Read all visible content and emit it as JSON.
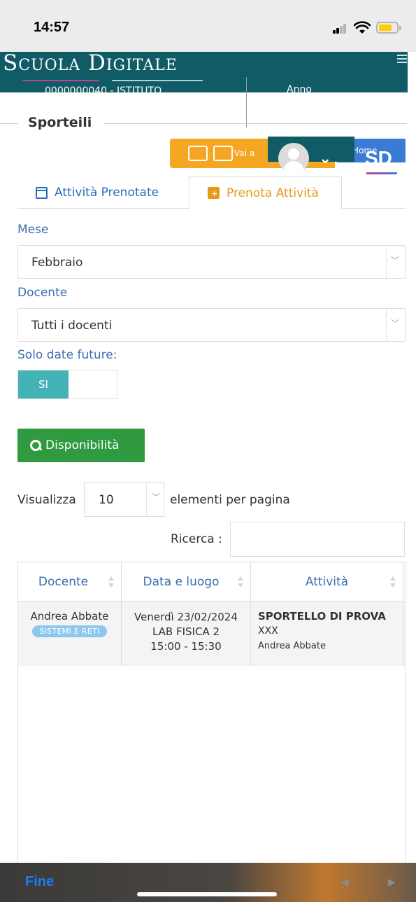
{
  "status_bar": {
    "time": "14:57"
  },
  "header": {
    "brand": "Scuola Digitale",
    "subtitle_left": "0000000040 - ISTITUTO",
    "subtitle_right": "Anno"
  },
  "page": {
    "section_title": "Sporteili"
  },
  "toolbar": {
    "vai_label": "Vai a",
    "home_label": "Home",
    "logo_text": "SD"
  },
  "tabs": [
    {
      "label": "Attività Prenotate",
      "active": false
    },
    {
      "label": "Prenota Attività",
      "active": true
    }
  ],
  "form": {
    "month_label": "Mese",
    "month_value": "Febbraio",
    "teacher_label": "Docente",
    "teacher_value": "Tutti i docenti",
    "future_label": "Solo date future:",
    "future_on_label": "SI",
    "availability_button": "Disponibilità"
  },
  "list_controls": {
    "show_label": "Visualizza",
    "page_length": "10",
    "per_page_label": "elementi per pagina",
    "search_label": "Ricerca :",
    "search_value": ""
  },
  "table": {
    "columns": [
      "Docente",
      "Data e luogo",
      "Attività"
    ],
    "rows": [
      {
        "teacher": "Andrea Abbate",
        "subject_badge": "SISTEMI E RETI",
        "date": "Venerdì 23/02/2024",
        "place": "LAB FISICA 2",
        "time": "15:00 - 15:30",
        "activity_title": "SPORTELLO DI PROVA",
        "activity_code": "XXX",
        "activity_teacher": "Andrea Abbate"
      }
    ]
  },
  "bottom_bar": {
    "done_label": "Fine"
  },
  "colors": {
    "header_teal": "#0f5c66",
    "accent_orange": "#e69a1a",
    "link_blue": "#3a6fb0",
    "button_green": "#2f9a3f",
    "toggle_teal": "#43b3b8",
    "badge_blue": "#8cc8ee"
  },
  "icons": {
    "signal": "cellular-signal-icon",
    "wifi": "wifi-icon",
    "battery": "battery-icon",
    "menu": "hamburger-menu-icon",
    "tab_booked": "calendar-check-icon",
    "tab_book": "calendar-plus-icon",
    "search": "search-icon",
    "sort": "sort-icon"
  }
}
